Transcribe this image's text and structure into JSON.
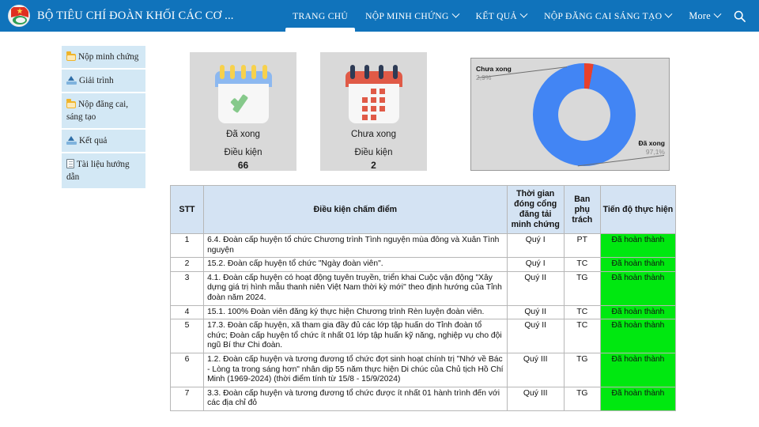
{
  "navbar": {
    "brand_title": "BỘ TIÊU CHÍ ĐOÀN KHỐI CÁC CƠ ...",
    "logo_name": "youth-union-emblem",
    "items": [
      {
        "label": "TRANG CHỦ",
        "has_caret": false,
        "active": true
      },
      {
        "label": "NỘP MINH CHỨNG",
        "has_caret": true,
        "active": false
      },
      {
        "label": "KẾT QUẢ",
        "has_caret": true,
        "active": false
      },
      {
        "label": "NỘP ĐĂNG CAI SÁNG TẠO",
        "has_caret": true,
        "active": false
      },
      {
        "label": "More",
        "has_caret": true,
        "active": false
      }
    ],
    "search_icon": "search-icon",
    "bg_color": "#1073bb"
  },
  "sidebar": {
    "items": [
      {
        "label": "Nộp minh chứng",
        "icon": "folder-icon"
      },
      {
        "label": "Giải trình",
        "icon": "upload-icon"
      },
      {
        "label": "Nộp đăng cai, sáng tạo",
        "icon": "folder-icon"
      },
      {
        "label": "Kết quả",
        "icon": "upload-icon"
      },
      {
        "label": "Tài liệu hướng dẫn",
        "icon": "document-icon"
      }
    ],
    "bg_color": "#d3e8f5"
  },
  "cards": [
    {
      "icon": "calendar-check-icon",
      "status": "Đã xong",
      "caption": "Điều kiện",
      "count": "66",
      "accent": "#86c98b"
    },
    {
      "icon": "calendar-dots-icon",
      "status": "Chưa xong",
      "caption": "Điều kiện",
      "count": "2",
      "accent": "#e05a47"
    }
  ],
  "chart_data": {
    "type": "pie",
    "title": "",
    "variant": "donut",
    "categories": [
      "Chưa xong",
      "Đã xong"
    ],
    "values": [
      2.9,
      97.1
    ],
    "labels": [
      "2,9%",
      "97,1%"
    ],
    "colors": [
      "#e8412c",
      "#4285f4"
    ],
    "legend_position": "callout-labels",
    "raw_counts": [
      2,
      66
    ],
    "xlabel": "",
    "ylabel": ""
  },
  "table": {
    "headers": [
      "STT",
      "Điều kiện chấm điểm",
      "Thời gian đóng cổng đăng tải minh chứng",
      "Ban phụ trách",
      "Tiến độ thực hiện"
    ],
    "progress_color": "#00e810",
    "rows": [
      {
        "stt": "1",
        "condition": "6.4. Đoàn cấp huyện tổ chức Chương trình Tình nguyện mùa đông và Xuân Tình nguyện",
        "time": "Quý I",
        "ban": "PT",
        "progress": "Đã hoàn thành"
      },
      {
        "stt": "2",
        "condition": "15.2. Đoàn cấp huyện tổ chức \"Ngày đoàn viên\".",
        "time": "Quý I",
        "ban": "TC",
        "progress": "Đã hoàn thành"
      },
      {
        "stt": "3",
        "condition": "4.1. Đoàn cấp huyện có hoạt động tuyên truyền, triển khai Cuộc vận động \"Xây dựng giá trị hình mẫu thanh niên Việt Nam thời kỳ mới\" theo định hướng của Tỉnh đoàn năm 2024.",
        "time": "Quý II",
        "ban": "TG",
        "progress": "Đã hoàn thành"
      },
      {
        "stt": "4",
        "condition": "15.1. 100% Đoàn viên đăng ký thực hiện Chương trình Rèn luyện đoàn viên.",
        "time": "Quý II",
        "ban": "TC",
        "progress": "Đã hoàn thành"
      },
      {
        "stt": "5",
        "condition": "17.3. Đoàn cấp huyện, xã tham gia đầy đủ các lớp tập huấn do Tỉnh đoàn tổ chức; Đoàn cấp huyện tổ chức ít nhất 01 lớp tập huấn kỹ năng, nghiệp vụ cho đội ngũ Bí thư Chi đoàn.",
        "time": "Quý II",
        "ban": "TC",
        "progress": "Đã hoàn thành"
      },
      {
        "stt": "6",
        "condition": "1.2. Đoàn cấp huyện và tương đương tổ chức đợt sinh hoạt chính trị \"Nhớ về Bác - Lòng ta trong sáng hơn\" nhân dịp 55 năm thực hiện Di chúc của Chủ tịch Hồ Chí Minh (1969-2024) (thời điểm tính từ 15/8 - 15/9/2024)",
        "time": "Quý III",
        "ban": "TG",
        "progress": "Đã hoàn thành"
      },
      {
        "stt": "7",
        "condition": "3.3. Đoàn cấp huyện và tương đương tổ chức được ít nhất 01 hành trình đến với các địa chỉ đỏ",
        "time": "Quý III",
        "ban": "TG",
        "progress": "Đã hoàn thành"
      }
    ]
  }
}
